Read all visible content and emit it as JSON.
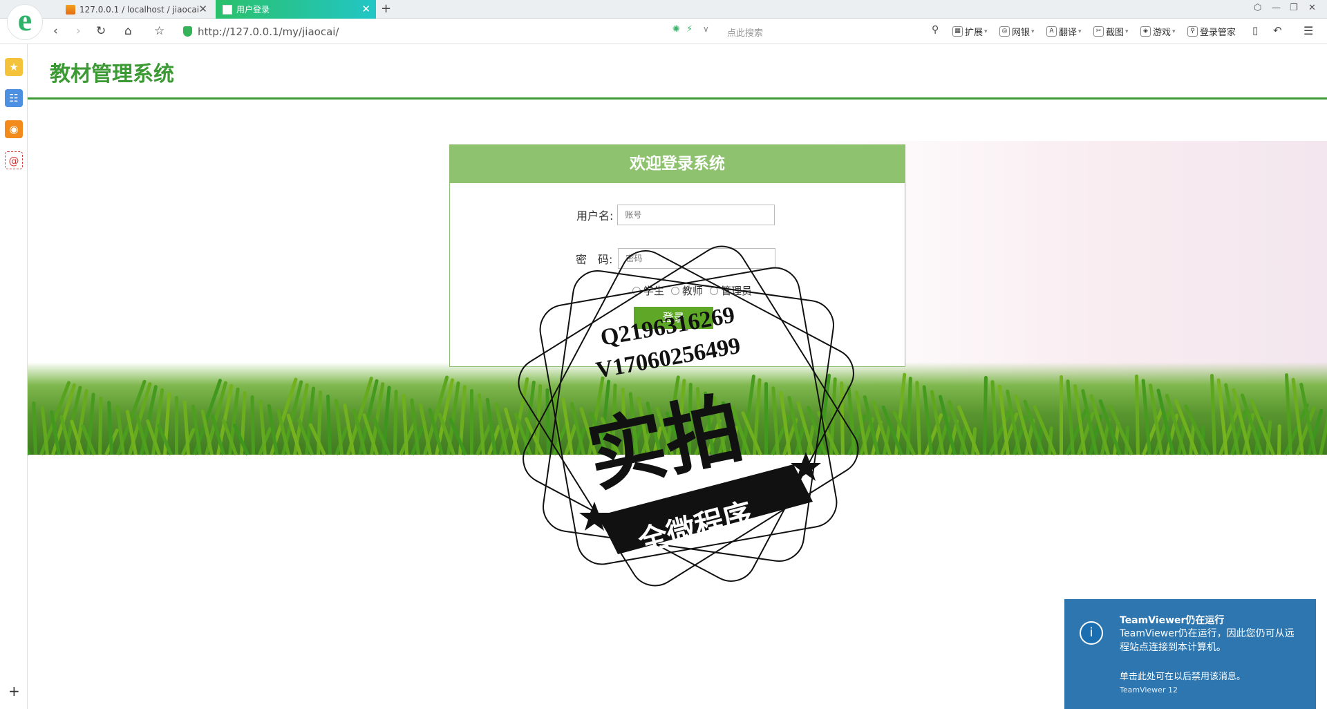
{
  "browser": {
    "tabs": [
      {
        "label": "127.0.0.1 / localhost / jiaocai"
      },
      {
        "label": "用户登录"
      }
    ],
    "url": "http://127.0.0.1/my/jiaocai/",
    "search_placeholder": "点此搜索",
    "toolbar": [
      {
        "label": "扩展"
      },
      {
        "label": "网银"
      },
      {
        "label": "翻译"
      },
      {
        "label": "截图"
      },
      {
        "label": "游戏"
      },
      {
        "label": "登录管家"
      }
    ]
  },
  "site": {
    "title": "教材管理系统"
  },
  "login": {
    "heading": "欢迎登录系统",
    "username_label": "用户名:",
    "username_placeholder": "账号",
    "password_label": "密　码:",
    "password_placeholder": "密码",
    "roles": [
      "学生",
      "教师",
      "管理员"
    ],
    "submit": "登录"
  },
  "stamp": {
    "line1": "Q2196316269",
    "line2": "V17060256499",
    "big": "实拍",
    "banner": "全微程序"
  },
  "notification": {
    "title": "TeamViewer仍在运行",
    "body": "TeamViewer仍在运行，因此您仍可从远程站点连接到本计算机。",
    "action": "单击此处可在以后禁用该消息。",
    "product": "TeamViewer 12"
  },
  "colors": {
    "brand_green": "#3c9a35",
    "login_header": "#8ec26f",
    "login_button": "#5fa827",
    "notify_blue": "#2d76b0"
  }
}
